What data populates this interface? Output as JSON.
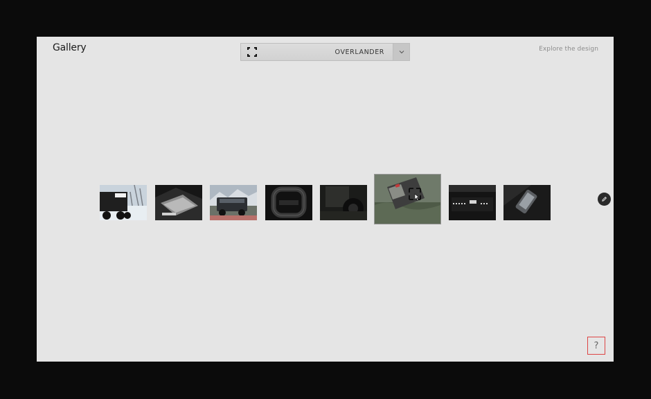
{
  "header": {
    "title": "Gallery",
    "explore_link": "Explore the design"
  },
  "selector": {
    "icon": "focus-frame-icon",
    "selected": "OVERLANDER",
    "chevron_icon": "chevron-down-icon"
  },
  "gallery": {
    "thumbnail_count": 8,
    "active_index": 5,
    "thumbnail_tones": [
      "snow-vehicle-rear",
      "bed-interior",
      "truck-mountain",
      "steering-yoke",
      "rear-wheel-dark",
      "vehicle-forest-tilt",
      "tailgate-dark",
      "phone-on-table"
    ]
  },
  "icons": {
    "edit": "pencil-icon",
    "help_label": "?"
  },
  "colors": {
    "page_background": "#0b0b0b",
    "panel": "#e5e5e5",
    "help_border": "#dd4444"
  }
}
